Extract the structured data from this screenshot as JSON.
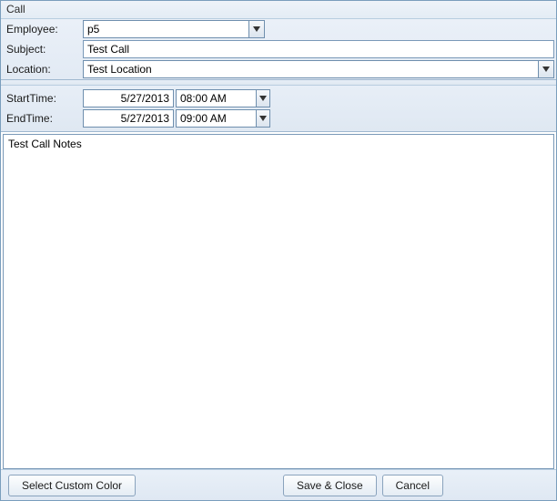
{
  "window": {
    "title": "Call"
  },
  "labels": {
    "employee": "Employee:",
    "subject": "Subject:",
    "location": "Location:",
    "startTime": "StartTime:",
    "endTime": "EndTime:"
  },
  "fields": {
    "employee": "p5",
    "subject": "Test Call",
    "location": "Test Location",
    "startDate": "5/27/2013",
    "startTime": "08:00 AM",
    "endDate": "5/27/2013",
    "endTime": "09:00 AM",
    "notes": "Test Call Notes"
  },
  "buttons": {
    "selectColor": "Select Custom Color",
    "saveClose": "Save & Close",
    "cancel": "Cancel"
  }
}
